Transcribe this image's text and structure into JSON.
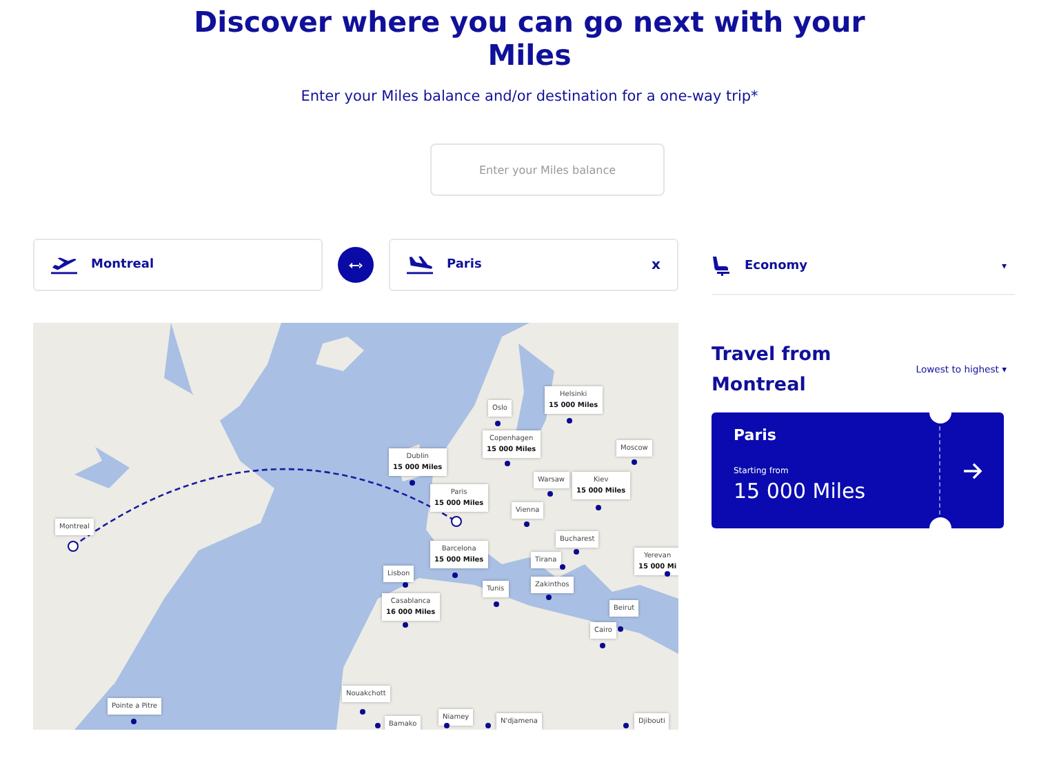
{
  "heading": "Discover where you can go next with your Miles",
  "subheading": "Enter your Miles balance and/or destination for a one-way trip*",
  "miles_input": {
    "placeholder": "Enter your Miles balance"
  },
  "origin": {
    "value": "Montreal"
  },
  "destination": {
    "value": "Paris",
    "clear": "x"
  },
  "cabin": {
    "value": "Economy",
    "caret": "▾"
  },
  "map": {
    "kind": "picture",
    "origin_label": "Montreal",
    "destinations": [
      {
        "city": "Pointe a Pitre",
        "selected": false
      },
      {
        "city": "Dublin",
        "miles": "15 000 Miles",
        "selected": false
      },
      {
        "city": "Paris",
        "miles": "15 000 Miles",
        "selected": true
      },
      {
        "city": "Oslo",
        "selected": false
      },
      {
        "city": "Copenhagen",
        "miles": "15 000 Miles",
        "selected": false
      },
      {
        "city": "Helsinki",
        "miles": "15 000 Miles",
        "selected": false
      },
      {
        "city": "Moscow",
        "selected": false
      },
      {
        "city": "Warsaw",
        "selected": false
      },
      {
        "city": "Kiev",
        "miles": "15 000 Miles",
        "selected": false
      },
      {
        "city": "Vienna",
        "selected": false
      },
      {
        "city": "Bucharest",
        "selected": false
      },
      {
        "city": "Barcelona",
        "miles": "15 000 Miles",
        "selected": false
      },
      {
        "city": "Tirana",
        "selected": false
      },
      {
        "city": "Zakinthos",
        "selected": false
      },
      {
        "city": "Lisbon",
        "selected": false
      },
      {
        "city": "Casablanca",
        "miles": "16 000 Miles",
        "selected": false
      },
      {
        "city": "Tunis",
        "selected": false
      },
      {
        "city": "Beirut",
        "selected": false
      },
      {
        "city": "Cairo",
        "selected": false
      },
      {
        "city": "Yerevan",
        "miles": "15 000 Mi",
        "selected": false
      },
      {
        "city": "Nouakchott",
        "selected": false
      },
      {
        "city": "Bamako",
        "selected": false
      },
      {
        "city": "Niamey",
        "selected": false
      },
      {
        "city": "N'djamena",
        "selected": false
      },
      {
        "city": "Djibouti",
        "selected": false
      }
    ]
  },
  "results": {
    "title": "Travel from Montreal",
    "sort": "Lowest to highest",
    "sort_caret": "▾",
    "cards": [
      {
        "city": "Paris",
        "caption": "Starting from",
        "price": "15 000 Miles"
      }
    ]
  }
}
